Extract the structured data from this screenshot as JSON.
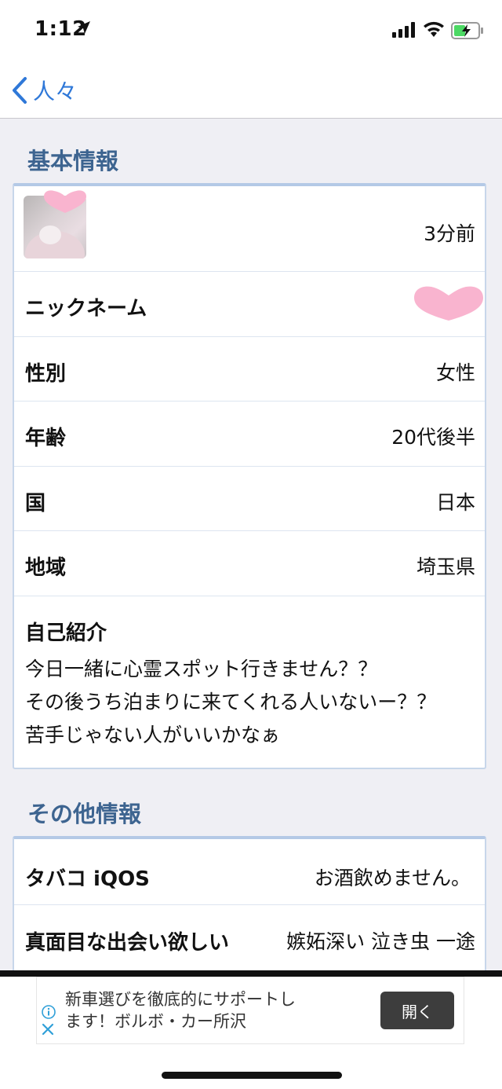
{
  "status_bar": {
    "time": "1:12"
  },
  "nav": {
    "back_label": "人々"
  },
  "basic": {
    "title": "基本情報",
    "last_seen": "3分前",
    "rows": [
      {
        "label": "ニックネーム",
        "value": ""
      },
      {
        "label": "性別",
        "value": "女性"
      },
      {
        "label": "年齢",
        "value": "20代後半"
      },
      {
        "label": "国",
        "value": "日本"
      },
      {
        "label": "地域",
        "value": "埼玉県"
      }
    ],
    "intro_label": "自己紹介",
    "intro_text": "今日一緒に心霊スポット行きません？？\nその後うち泊まりに来てくれる人いないー？？\n苦手じゃない人がいいかなぁ"
  },
  "other": {
    "title": "その他情報",
    "rows": [
      {
        "label": "タバコ iQOS",
        "value": "お酒飲めません。"
      },
      {
        "label": "真面目な出会い欲しい",
        "value": "嫉妬深い 泣き虫 一途"
      }
    ]
  },
  "ad": {
    "text": "新車選びを徹底的にサポートし\nます！ボルボ・カー所沢",
    "button": "開く"
  },
  "colors": {
    "accent": "#2f78d8",
    "section_title": "#3d6490",
    "heart_sticker": "#f9b4cf"
  },
  "icons": [
    "chevron-left-icon",
    "location-arrow-icon",
    "signal-icon",
    "wifi-icon",
    "battery-charging-icon",
    "info-icon",
    "close-icon",
    "heart-sticker"
  ]
}
